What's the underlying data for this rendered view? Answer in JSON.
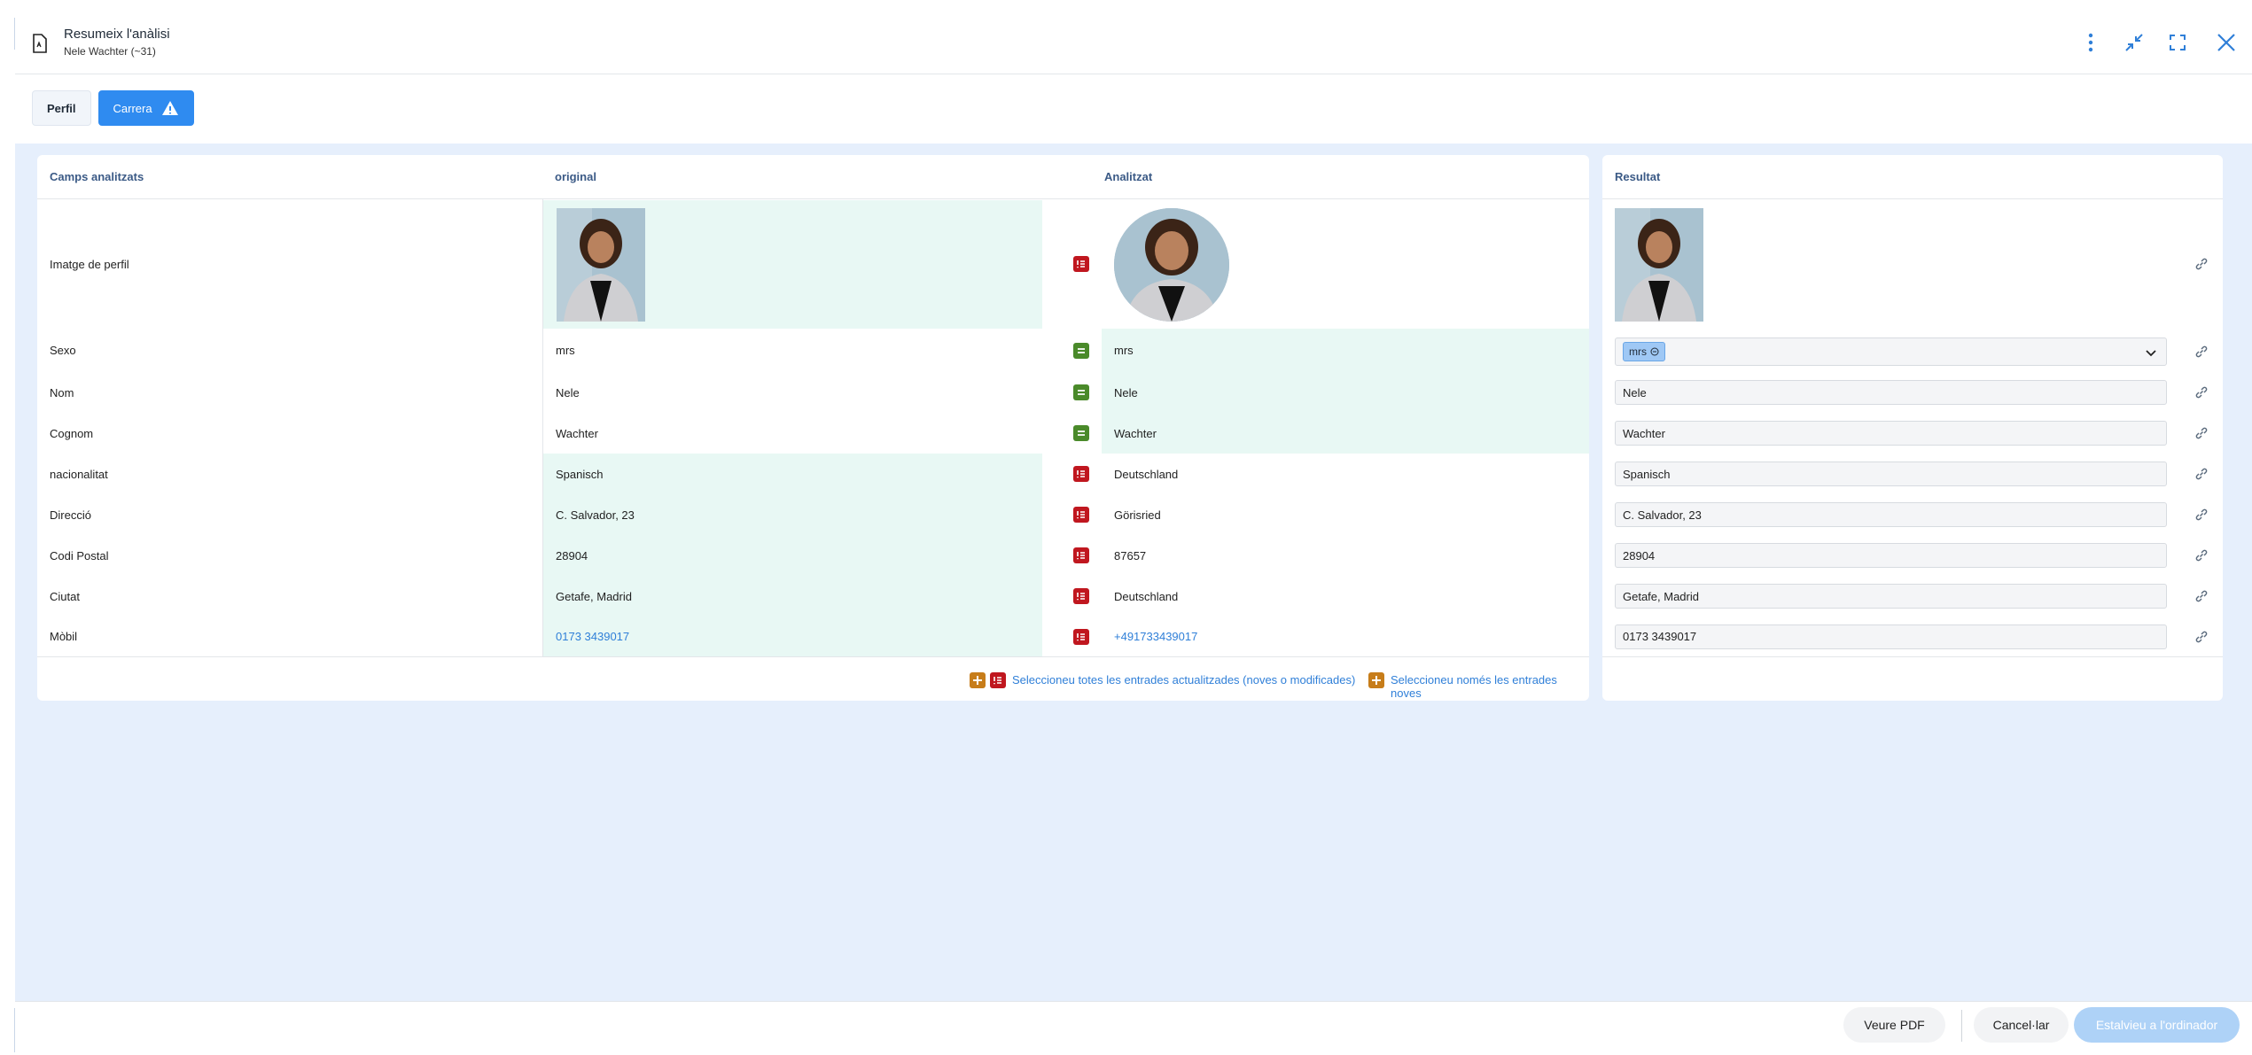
{
  "header": {
    "title": "Resumeix l'anàlisi",
    "subtitle": "Nele Wachter (~31)"
  },
  "tabs": [
    {
      "label": "Perfil",
      "active": false
    },
    {
      "label": "Carrera",
      "active": true,
      "warning": true
    }
  ],
  "table": {
    "headers": {
      "fields": "Camps analitzats",
      "original": "original",
      "analyzed": "Analitzat",
      "result": "Resultat"
    },
    "rows": [
      {
        "label": "Imatge de perfil",
        "original": "",
        "analyzed": "",
        "result": "",
        "status": "diff"
      },
      {
        "label": "Sexo",
        "original": "mrs",
        "analyzed": "mrs",
        "result": "mrs",
        "status": "same"
      },
      {
        "label": "Nom",
        "original": "Nele",
        "analyzed": "Nele",
        "result": "Nele",
        "status": "same"
      },
      {
        "label": "Cognom",
        "original": "Wachter",
        "analyzed": "Wachter",
        "result": "Wachter",
        "status": "same"
      },
      {
        "label": "nacionalitat",
        "original": "Spanisch",
        "analyzed": "Deutschland",
        "result": "Spanisch",
        "status": "diff"
      },
      {
        "label": "Direcció",
        "original": "C. Salvador, 23",
        "analyzed": "Görisried",
        "result": "C. Salvador, 23",
        "status": "diff"
      },
      {
        "label": "Codi Postal",
        "original": "28904",
        "analyzed": "87657",
        "result": "28904",
        "status": "diff"
      },
      {
        "label": "Ciutat",
        "original": "Getafe, Madrid",
        "analyzed": "Deutschland",
        "result": "Getafe, Madrid",
        "status": "diff"
      },
      {
        "label": "Mòbil",
        "original": "0173 3439017",
        "analyzed": "+491733439017",
        "result": "0173 3439017",
        "status": "diff"
      }
    ],
    "footer": {
      "select_updated": "Seleccioneu totes les entrades actualitzades (noves o modificades)",
      "select_new": "Seleccioneu només les entrades noves"
    }
  },
  "actions": {
    "view_pdf": "Veure PDF",
    "cancel": "Cancel·lar",
    "save": "Estalvieu a l'ordinador"
  },
  "colors": {
    "accent": "#2f8bf0",
    "diff": "#c0171f",
    "same": "#4a8a2a",
    "new": "#c77d1a",
    "highlight": "#e8f8f4",
    "content_bg": "#e6effc"
  }
}
